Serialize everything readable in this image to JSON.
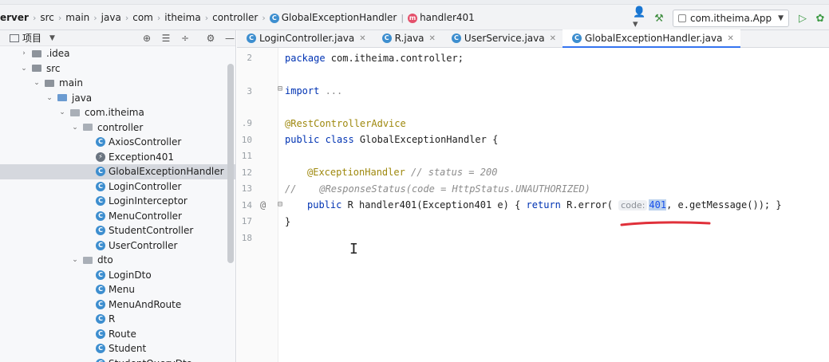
{
  "breadcrumb": {
    "items": [
      "erver",
      "src",
      "main",
      "java",
      "com",
      "itheima",
      "controller"
    ],
    "class_name": "GlobalExceptionHandler",
    "method_name": "handler401"
  },
  "toolbar": {
    "run_config": "com.itheima.App"
  },
  "project": {
    "title": "项目",
    "tree": [
      {
        "label": ".idea",
        "kind": "folder",
        "depth": 1,
        "twisty": "›"
      },
      {
        "label": "src",
        "kind": "folder",
        "depth": 1,
        "twisty": "⌄"
      },
      {
        "label": "main",
        "kind": "folder",
        "depth": 2,
        "twisty": "⌄"
      },
      {
        "label": "java",
        "kind": "folder-blue",
        "depth": 3,
        "twisty": "⌄"
      },
      {
        "label": "com.itheima",
        "kind": "package",
        "depth": 4,
        "twisty": "⌄"
      },
      {
        "label": "controller",
        "kind": "package",
        "depth": 5,
        "twisty": "⌄"
      },
      {
        "label": "AxiosController",
        "kind": "class",
        "depth": 6
      },
      {
        "label": "Exception401",
        "kind": "exception",
        "depth": 6
      },
      {
        "label": "GlobalExceptionHandler",
        "kind": "class",
        "depth": 6,
        "selected": true
      },
      {
        "label": "LoginController",
        "kind": "class",
        "depth": 6
      },
      {
        "label": "LoginInterceptor",
        "kind": "class",
        "depth": 6
      },
      {
        "label": "MenuController",
        "kind": "class",
        "depth": 6
      },
      {
        "label": "StudentController",
        "kind": "class",
        "depth": 6
      },
      {
        "label": "UserController",
        "kind": "class",
        "depth": 6
      },
      {
        "label": "dto",
        "kind": "package",
        "depth": 5,
        "twisty": "⌄"
      },
      {
        "label": "LoginDto",
        "kind": "class",
        "depth": 6
      },
      {
        "label": "Menu",
        "kind": "class",
        "depth": 6
      },
      {
        "label": "MenuAndRoute",
        "kind": "class",
        "depth": 6
      },
      {
        "label": "R",
        "kind": "class",
        "depth": 6
      },
      {
        "label": "Route",
        "kind": "class",
        "depth": 6
      },
      {
        "label": "Student",
        "kind": "class",
        "depth": 6
      },
      {
        "label": "StudentQueryDto",
        "kind": "class",
        "depth": 6
      }
    ]
  },
  "tabs": [
    {
      "label": "LoginController.java",
      "active": false
    },
    {
      "label": "R.java",
      "active": false
    },
    {
      "label": "UserService.java",
      "active": false
    },
    {
      "label": "GlobalExceptionHandler.java",
      "active": true
    }
  ],
  "editor": {
    "line_numbers": [
      "2",
      "",
      "3",
      "",
      ".9",
      "10",
      "11",
      "12",
      "13",
      "14",
      "17",
      "18"
    ],
    "code": {
      "package_kw": "package",
      "package_name": " com.itheima.controller;",
      "import_kw": "import",
      "import_rest": " ...",
      "annotation1": "@RestControllerAdvice",
      "class_decl_kw": "public class",
      "class_decl_name": " GlobalExceptionHandler {",
      "annotation2": "@ExceptionHandler",
      "annotation2_comment": " // status = 200",
      "comment_line": "//    @ResponseStatus(code = HttpStatus.UNAUTHORIZED)",
      "method_kw": "public",
      "method_sig": " R handler401(Exception401 e) { ",
      "return_kw": "return",
      "return_call": " R.error(",
      "param_hint": "code:",
      "param_value": "401",
      "return_rest": ", e.getMessage()); }",
      "closing_brace": "}"
    }
  },
  "colors": {
    "keyword": "#0033b3",
    "annotation": "#9e880d",
    "comment": "#8c8c8c",
    "number": "#1750eb",
    "underline_mark": "#e0303a",
    "active_tab_accent": "#3574f0"
  }
}
